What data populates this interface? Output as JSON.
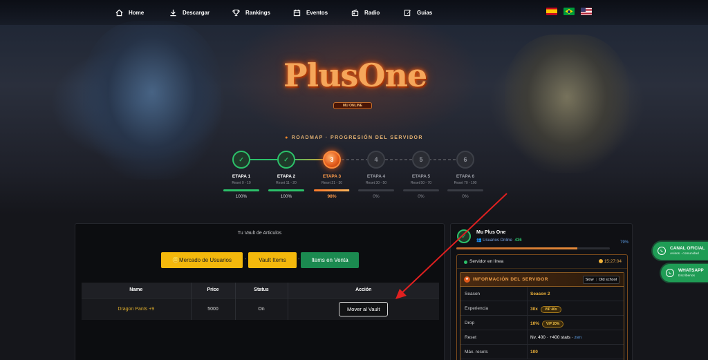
{
  "nav": {
    "items": [
      {
        "label": "Home",
        "icon": "home-icon"
      },
      {
        "label": "Descargar",
        "icon": "download-icon"
      },
      {
        "label": "Rankings",
        "icon": "trophy-icon"
      },
      {
        "label": "Eventos",
        "icon": "calendar-icon"
      },
      {
        "label": "Radio",
        "icon": "radio-icon"
      },
      {
        "label": "Guias",
        "icon": "edit-icon"
      }
    ],
    "languages": [
      "es",
      "pt-br",
      "en-us"
    ]
  },
  "logo": {
    "text": "PlusOne",
    "subtitle": "MU ONLINE"
  },
  "roadmap": {
    "title": "ROADMAP · PROGRESIÓN DEL SERVIDOR",
    "stages": [
      {
        "name": "ETAPA 1",
        "levels": "Reset 0 - 10",
        "progress": "100%",
        "status": "done",
        "fill": 1.0,
        "marker": "✓"
      },
      {
        "name": "ETAPA 2",
        "levels": "Reset 11 - 20",
        "progress": "100%",
        "status": "done",
        "fill": 1.0,
        "marker": "✓"
      },
      {
        "name": "ETAPA 3",
        "levels": "Reset 21 - 30",
        "progress": "98%",
        "status": "active",
        "fill": 0.98,
        "marker": "3"
      },
      {
        "name": "ETAPA 4",
        "levels": "Reset 30 - 50",
        "progress": "0%",
        "status": "todo",
        "fill": 0.0,
        "marker": "4"
      },
      {
        "name": "ETAPA 5",
        "levels": "Reset 50 - 70",
        "progress": "0%",
        "status": "todo",
        "fill": 0.0,
        "marker": "5"
      },
      {
        "name": "ETAPA 6",
        "levels": "Reset 70 - 100",
        "progress": "0%",
        "status": "todo",
        "fill": 0.0,
        "marker": "6"
      }
    ]
  },
  "vault": {
    "title": "Tu Vault de Articulos",
    "buttons": {
      "market": "🪙Mercado de Usuarios",
      "vault_items": "Vault Items",
      "for_sale": "Items en Venta"
    },
    "separator": "-",
    "table": {
      "headers": [
        "Name",
        "Price",
        "Status",
        "Acción"
      ],
      "rows": [
        {
          "name": "Dragon Pants +9",
          "price": "5000",
          "status": "On",
          "action": "Mover al Vault"
        }
      ]
    }
  },
  "server": {
    "name": "Mu Plus One",
    "online_label": "Usuarios Online",
    "online_count": "436",
    "load_percent": "79%",
    "load_fill": 0.79,
    "status": "Servidor en línea",
    "time": "15:27:04",
    "info_title": "INFORMACIÓN DEL SERVIDOR",
    "toggle": [
      "Slow",
      "Old school"
    ],
    "rows": [
      {
        "key": "Season",
        "value": "Season 2",
        "style": "gold"
      },
      {
        "key": "Experiencia",
        "value": "30x",
        "pill": "VIP 40x",
        "style": "gold"
      },
      {
        "key": "Drop",
        "value": "10%",
        "pill": "VIP 20%",
        "style": "gold"
      },
      {
        "key": "Reset",
        "value": "Nv. 400 · +400 stats · ",
        "suffix": "zen",
        "style": "plain"
      },
      {
        "key": "Máx. resets",
        "value": "100",
        "style": "gold"
      }
    ]
  },
  "whatsapp": {
    "channel_title": "CANAL OFICIAL",
    "channel_sub": "Avisos · comunidad",
    "chat_title": "WHATSAPP",
    "chat_sub": "Escríbenos"
  },
  "colors": {
    "accent_orange": "#e2591a",
    "success_green": "#2cc16a",
    "button_yellow": "#f4b80c",
    "button_green": "#1b8a50",
    "gold_text": "#f0b43a",
    "annotation_red": "#e02020"
  }
}
